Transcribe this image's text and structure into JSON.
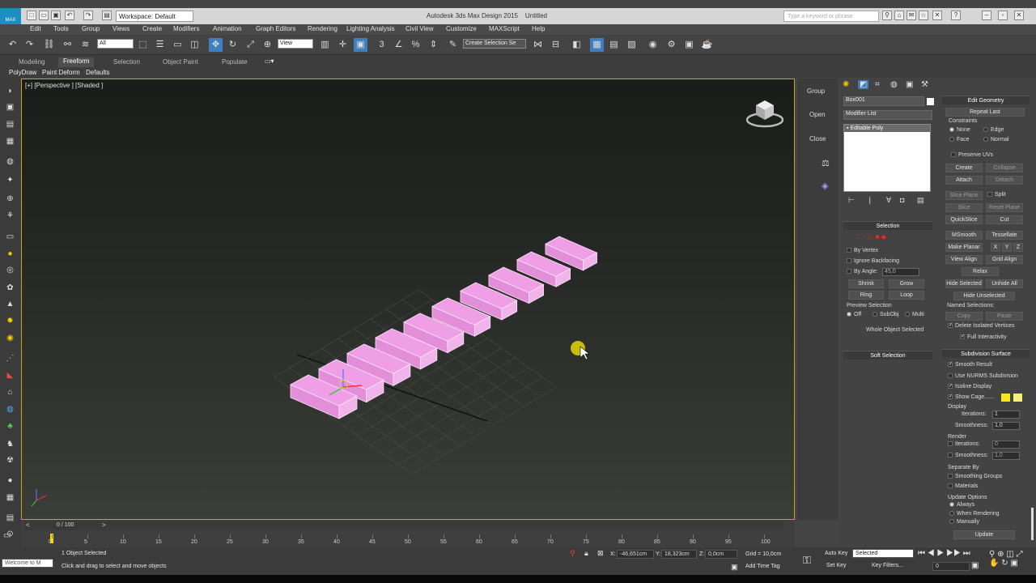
{
  "titlebar": {
    "app_title": "Autodesk 3ds Max Design 2015",
    "doc_title": "Untitled",
    "workspace": "Workspace: Default",
    "search_placeholder": "Type a keyword or phrase",
    "logo": "MAX"
  },
  "menu": [
    "Edit",
    "Tools",
    "Group",
    "Views",
    "Create",
    "Modifiers",
    "Animation",
    "Graph Editors",
    "Rendering",
    "Lighting Analysis",
    "Civil View",
    "Customize",
    "MAXScript",
    "Help"
  ],
  "toolbar": {
    "filter_value": "All",
    "refcoord_value": "View",
    "selection_set": "Create Selection Se"
  },
  "ribbon": {
    "tabs": [
      "Modeling",
      "Freeform",
      "Selection",
      "Object Paint",
      "Populate"
    ],
    "active_tab": "Freeform",
    "subtabs": [
      "PolyDraw",
      "Paint Deform",
      "Defaults"
    ]
  },
  "viewport": {
    "label": "[+] [Perspective ] [Shaded ]",
    "box_color": "#ee9fe6",
    "box_count": 10
  },
  "scene_strip": {
    "items": [
      "Group",
      "Open",
      "Close"
    ]
  },
  "command_panel": {
    "object_name": "Box001",
    "modifier_list": "Modifier List",
    "stack_item": "Editable Poly",
    "selection": {
      "title": "Selection",
      "by_vertex": "By Vertex",
      "ignore_backfacing": "Ignore Backfacing",
      "by_angle": "By Angle:",
      "by_angle_value": "45,0",
      "shrink": "Shrink",
      "grow": "Grow",
      "ring": "Ring",
      "loop": "Loop",
      "preview_selection": "Preview Selection",
      "preview_off": "Off",
      "preview_subobj": "SubObj",
      "preview_multi": "Multi",
      "whole_object": "Whole Object Selected"
    },
    "soft_selection": "Soft Selection",
    "edit_geometry": {
      "title": "Edit Geometry",
      "repeat_last": "Repeat Last",
      "constraints": "Constraints",
      "none": "None",
      "edge": "Edge",
      "face": "Face",
      "normal": "Normal",
      "preserve_uvs": "Preserve UVs",
      "create": "Create",
      "collapse": "Collapse",
      "attach": "Attach",
      "detach": "Detach",
      "slice_plane": "Slice Plane",
      "split": "Split",
      "slice": "Slice",
      "reset_plane": "Reset Plane",
      "quickslice": "QuickSlice",
      "cut": "Cut",
      "msmooth": "MSmooth",
      "tessellate": "Tessellate",
      "make_planar": "Make Planar",
      "x": "X",
      "y": "Y",
      "z": "Z",
      "view_align": "View Align",
      "grid_align": "Grid Align",
      "relax": "Relax",
      "hide_selected": "Hide Selected",
      "unhide_all": "Unhide All",
      "hide_unselected": "Hide Unselected",
      "named_selections": "Named Selections:",
      "copy": "Copy",
      "paste": "Paste",
      "delete_isolated": "Delete Isolated Vertices",
      "full_interactivity": "Full Interactivity"
    },
    "subdivision": {
      "title": "Subdivision Surface",
      "smooth_result": "Smooth Result",
      "use_nurms": "Use NURMS Subdivision",
      "isoline": "Isoline Display",
      "show_cage": "Show Cage......",
      "display": "Display",
      "iterations": "Iterations:",
      "iterations_value": "1",
      "smoothness": "Smoothness:",
      "smoothness_value": "1,0",
      "render": "Render",
      "render_iterations_value": "0",
      "render_smoothness_value": "1,0",
      "separate_by": "Separate By",
      "smoothing_groups": "Smoothing Groups",
      "materials": "Materials",
      "update_options": "Update Options",
      "always": "Always",
      "when_rendering": "When Rendering",
      "manually": "Manually",
      "update": "Update"
    },
    "cage_color_1": "#f5e81d",
    "cage_color_2": "#f4f07a"
  },
  "timeline": {
    "frame_display": "0 / 100",
    "ticks": [
      "0",
      "5",
      "10",
      "15",
      "20",
      "25",
      "30",
      "35",
      "40",
      "45",
      "50",
      "55",
      "60",
      "65",
      "70",
      "75",
      "80",
      "85",
      "90",
      "95",
      "100"
    ]
  },
  "status": {
    "welcome": "Welcome to M",
    "selected": "1 Object Selected",
    "prompt": "Click and drag to select and move objects",
    "x_label": "X:",
    "x_value": "-46,651cm",
    "y_label": "Y:",
    "y_value": "18,323cm",
    "z_label": "Z:",
    "z_value": "0,0cm",
    "grid": "Grid = 10,0cm",
    "add_time_tag": "Add Time Tag",
    "auto_key": "Auto Key",
    "set_key": "Set Key",
    "selected_dropdown": "Selected",
    "key_filters": "Key Filters...",
    "frame_value": "0"
  }
}
